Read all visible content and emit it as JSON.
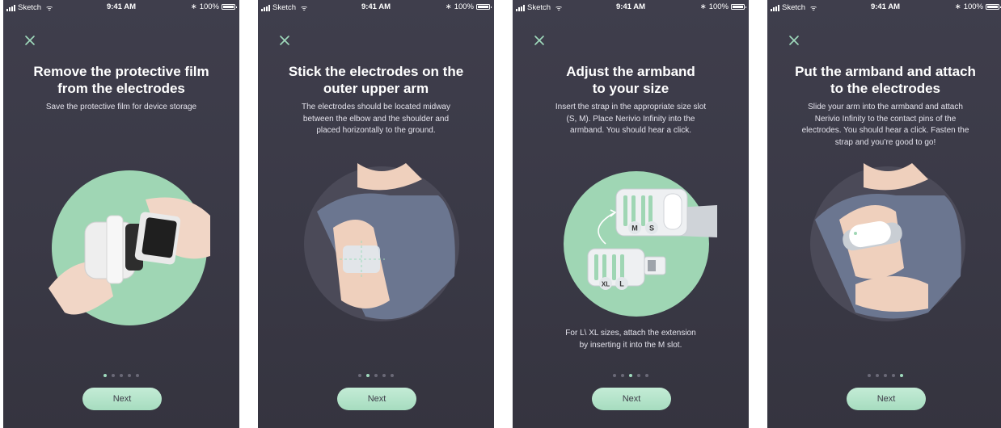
{
  "status_bar": {
    "carrier": "Sketch",
    "time": "9:41 AM",
    "battery": "100%"
  },
  "screens": [
    {
      "title": "Remove the protective film\nfrom the electrodes",
      "subtitle": "Save the protective film for device storage",
      "note": "",
      "active_dot": 0,
      "next_label": "Next"
    },
    {
      "title": "Stick the electrodes on the\nouter upper arm",
      "subtitle": "The electrodes should be located midway\nbetween the elbow and the shoulder and\nplaced horizontally to the ground.",
      "note": "",
      "active_dot": 1,
      "next_label": "Next"
    },
    {
      "title": "Adjust the armband\nto your size",
      "subtitle": "Insert the strap in the appropriate size slot\n(S, M). Place Nerivio Infinity into the\narmband. You should hear a click.",
      "note": "For L\\ XL sizes, attach the extension\nby inserting it into the M slot.",
      "active_dot": 2,
      "next_label": "Next",
      "slot_labels": [
        "M",
        "S",
        "XL",
        "L"
      ]
    },
    {
      "title": "Put the armband and attach\nto the electrodes",
      "subtitle": "Slide your arm into the armband and attach\nNerivio Infinity to the contact pins of the\nelectrodes. You should hear a click. Fasten the\nstrap and you’re good to go!",
      "note": "",
      "active_dot": 4,
      "next_label": "Next"
    }
  ],
  "colors": {
    "background": "#3a3946",
    "accent": "#a6dcbf",
    "circle_green": "#9fd6b4",
    "circle_dark": "#4b4a58"
  },
  "icons": {
    "close": "close-icon",
    "signal": "signal-icon",
    "wifi": "wifi-icon",
    "bluetooth": "bluetooth-icon",
    "battery": "battery-icon"
  }
}
